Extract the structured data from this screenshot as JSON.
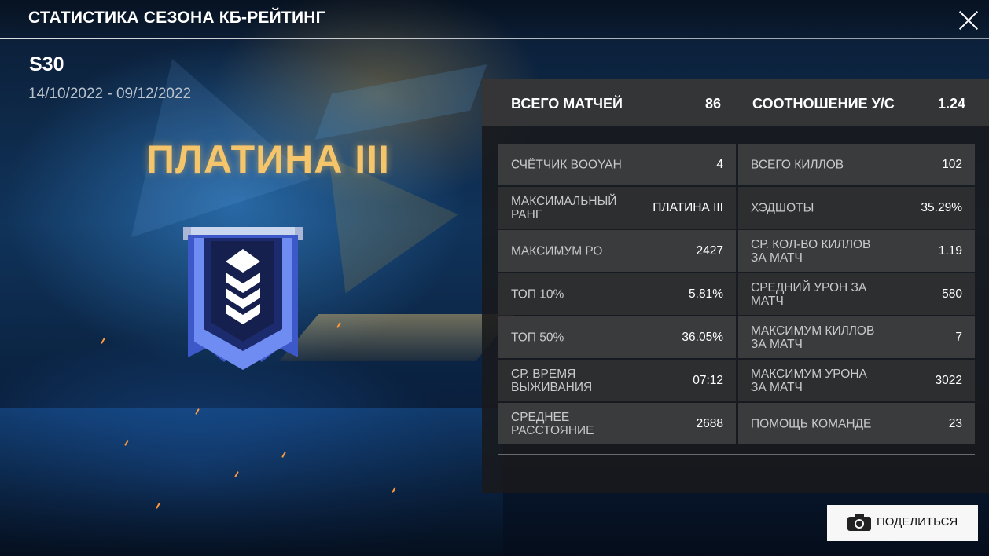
{
  "header": {
    "title": "СТАТИСТИКА СЕЗОНА КБ-РЕЙТИНГ"
  },
  "season": {
    "name": "S30",
    "dates": "14/10/2022 - 09/12/2022",
    "rank": "ПЛАТИНА III"
  },
  "summary": {
    "matches_label": "ВСЕГО МАТЧЕЙ",
    "matches_value": "86",
    "kd_label": "СООТНОШЕНИЕ У/С",
    "kd_value": "1.24"
  },
  "stats_left": [
    {
      "label": "СЧЁТЧИК BOOYAH",
      "value": "4"
    },
    {
      "label": "МАКСИМАЛЬНЫЙ РАНГ",
      "value": "ПЛАТИНА III"
    },
    {
      "label": "МАКСИМУМ РО",
      "value": "2427"
    },
    {
      "label": "ТОП 10%",
      "value": "5.81%"
    },
    {
      "label": "ТОП 50%",
      "value": "36.05%"
    },
    {
      "label": "СР. ВРЕМЯ ВЫЖИВАНИЯ",
      "value": "07:12"
    },
    {
      "label": "СРЕДНЕЕ РАССТОЯНИЕ",
      "value": "2688"
    }
  ],
  "stats_right": [
    {
      "label": "ВСЕГО КИЛЛОВ",
      "value": "102"
    },
    {
      "label": "ХЭДШОТЫ",
      "value": "35.29%"
    },
    {
      "label": "СР. КОЛ-ВО КИЛЛОВ ЗА МАТЧ",
      "value": "1.19"
    },
    {
      "label": "СРЕДНИЙ УРОН ЗА МАТЧ",
      "value": "580"
    },
    {
      "label": "МАКСИМУМ КИЛЛОВ ЗА МАТЧ",
      "value": "7"
    },
    {
      "label": "МАКСИМУМ УРОНА ЗА МАТЧ",
      "value": "3022"
    },
    {
      "label": "ПОМОЩЬ КОМАНДЕ",
      "value": "23"
    }
  ],
  "actions": {
    "share_label": "ПОДЕЛИТЬСЯ",
    "share_icon": "camera-icon",
    "close_icon": "close-icon"
  },
  "colors": {
    "rank_gold": "#f4c56a",
    "badge_blue": "#5b78e6",
    "panel_bg": "#19191b"
  }
}
